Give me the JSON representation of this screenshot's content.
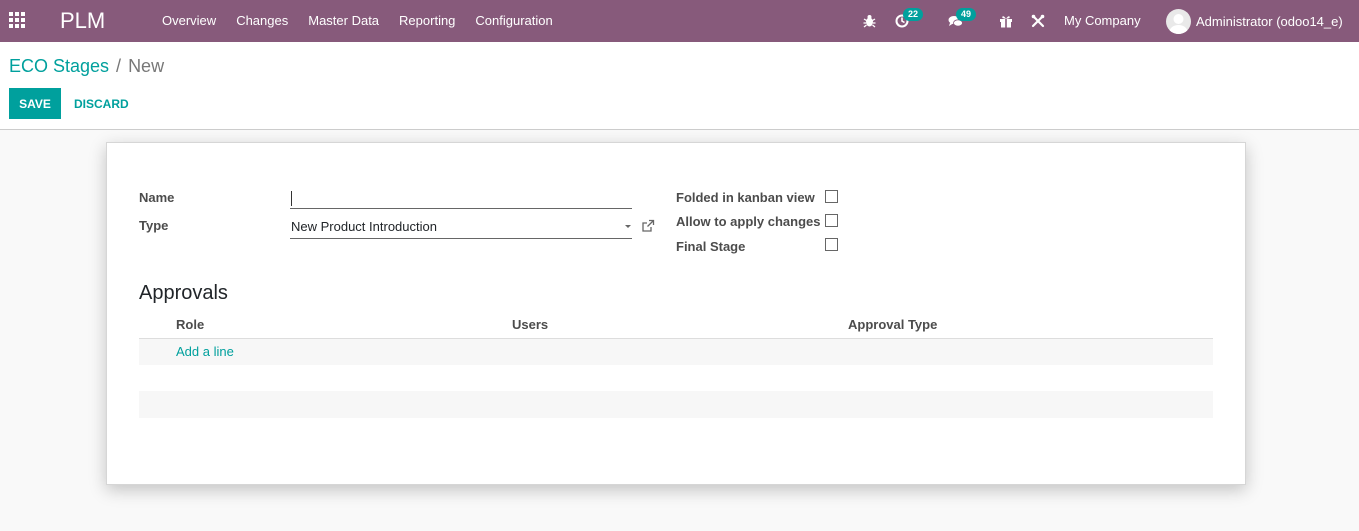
{
  "navbar": {
    "app_name": "PLM",
    "menu": [
      "Overview",
      "Changes",
      "Master Data",
      "Reporting",
      "Configuration"
    ],
    "activity_count": "22",
    "messages_count": "49",
    "company": "My Company",
    "user": "Administrator (odoo14_e)",
    "icons": [
      "apps-grid-icon",
      "bug-icon",
      "clock-icon",
      "chat-icon",
      "gift-icon",
      "tools-icon"
    ]
  },
  "breadcrumb": {
    "parent": "ECO Stages",
    "separator": "/",
    "current": "New"
  },
  "actions": {
    "save": "SAVE",
    "discard": "DISCARD"
  },
  "form": {
    "name_label": "Name",
    "name_value": "",
    "type_label": "Type",
    "type_value": "New Product Introduction",
    "checkboxes": [
      {
        "label": "Folded in kanban view",
        "checked": false
      },
      {
        "label": "Allow to apply changes",
        "checked": false
      },
      {
        "label": "Final Stage",
        "checked": false
      }
    ]
  },
  "approvals": {
    "title": "Approvals",
    "columns": [
      "Role",
      "Users",
      "Approval Type"
    ],
    "add_line": "Add a line"
  },
  "colors": {
    "brand": "#875a7b",
    "accent": "#00a09d"
  }
}
